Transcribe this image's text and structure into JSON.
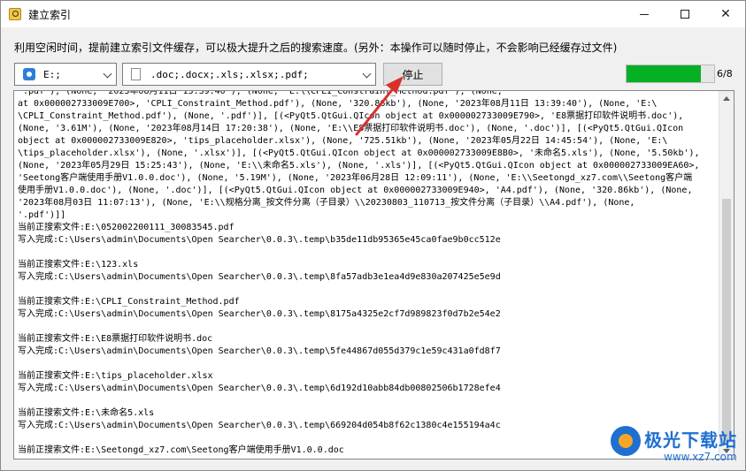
{
  "window": {
    "title": "建立索引",
    "controls": {
      "minimize": "minimize",
      "maximize": "maximize",
      "close": "✕"
    }
  },
  "info_line": "利用空闲时间，提前建立索引文件缓存，可以极大提升之后的搜索速度。(另外：本操作可以随时停止，不会影响已经缓存过文件)",
  "toolbar": {
    "drive_value": "E:;",
    "extensions_value": ".doc;.docx;.xls;.xlsx;.pdf;",
    "stop_label": "停止",
    "progress_fraction": 0.85,
    "progress_text": "6/8"
  },
  "log_lines": [
    "'.pdf'), (None, '2023年08月11日 13:39:40'), (None, 'E:\\\\CPLI_Constraint_Method.pdf'), (None,",
    "at 0x000002733009E700>, 'CPLI_Constraint_Method.pdf'), (None, '320.86kb'), (None, '2023年08月11日 13:39:40'), (None, 'E:\\",
    "\\CPLI_Constraint_Method.pdf'), (None, '.pdf')], [(<PyQt5.QtGui.QIcon object at 0x000002733009E790>, 'E8票据打印软件说明书.doc'),",
    "(None, '3.61M'), (None, '2023年08月14日 17:20:38'), (None, 'E:\\\\E8票据打印软件说明书.doc'), (None, '.doc')], [(<PyQt5.QtGui.QIcon",
    "object at 0x000002733009E820>, 'tips_placeholder.xlsx'), (None, '725.51kb'), (None, '2023年05月22日 14:45:54'), (None, 'E:\\",
    "\\tips_placeholder.xlsx'), (None, '.xlsx')], [(<PyQt5.QtGui.QIcon object at 0x000002733009E8B0>, '未命名5.xls'), (None, '5.50kb'),",
    "(None, '2023年05月29日 15:25:43'), (None, 'E:\\\\未命名5.xls'), (None, '.xls')], [(<PyQt5.QtGui.QIcon object at 0x000002733009EA60>,",
    "'Seetong客户端使用手册V1.0.0.doc'), (None, '5.19M'), (None, '2023年06月28日 12:09:11'), (None, 'E:\\\\Seetongd_xz7.com\\\\Seetong客户端",
    "使用手册V1.0.0.doc'), (None, '.doc')], [(<PyQt5.QtGui.QIcon object at 0x000002733009E940>, 'A4.pdf'), (None, '320.86kb'), (None,",
    "'2023年08月03日 11:07:13'), (None, 'E:\\\\规格分离_按文件分离（子目录）\\\\20230803_110713_按文件分离（子目录）\\\\A4.pdf'), (None,",
    "'.pdf')]]",
    "当前正搜索文件:E:\\052002200111_30083545.pdf",
    "写入完成:C:\\Users\\admin\\Documents\\Open Searcher\\0.0.3\\.temp\\b35de11db95365e45ca0fae9b0cc512e",
    "",
    "当前正搜索文件:E:\\123.xls",
    "写入完成:C:\\Users\\admin\\Documents\\Open Searcher\\0.0.3\\.temp\\8fa57adb3e1ea4d9e830a207425e5e9d",
    "",
    "当前正搜索文件:E:\\CPLI_Constraint_Method.pdf",
    "写入完成:C:\\Users\\admin\\Documents\\Open Searcher\\0.0.3\\.temp\\8175a4325e2cf7d989823f0d7b2e54e2",
    "",
    "当前正搜索文件:E:\\E8票据打印软件说明书.doc",
    "写入完成:C:\\Users\\admin\\Documents\\Open Searcher\\0.0.3\\.temp\\5fe44867d055d379c1e59c431a0fd8f7",
    "",
    "当前正搜索文件:E:\\tips_placeholder.xlsx",
    "写入完成:C:\\Users\\admin\\Documents\\Open Searcher\\0.0.3\\.temp\\6d192d10abb84db00802506b1728efe4",
    "",
    "当前正搜索文件:E:\\未命名5.xls",
    "写入完成:C:\\Users\\admin\\Documents\\Open Searcher\\0.0.3\\.temp\\669204d054b8f62c1380c4e155194a4c",
    "",
    "当前正搜索文件:E:\\Seetongd_xz7.com\\Seetong客户端使用手册V1.0.0.doc"
  ],
  "watermark": {
    "title": "极光下载站",
    "url": "www.xz7.com"
  },
  "colors": {
    "progress_fill": "#06b025",
    "annotation_arrow": "#d9302c",
    "watermark": "#1f6fd1"
  },
  "icons": {
    "app": "app-search-icon",
    "drive": "drive-icon",
    "file": "file-icon",
    "dropdown": "chevron-down-icon"
  }
}
